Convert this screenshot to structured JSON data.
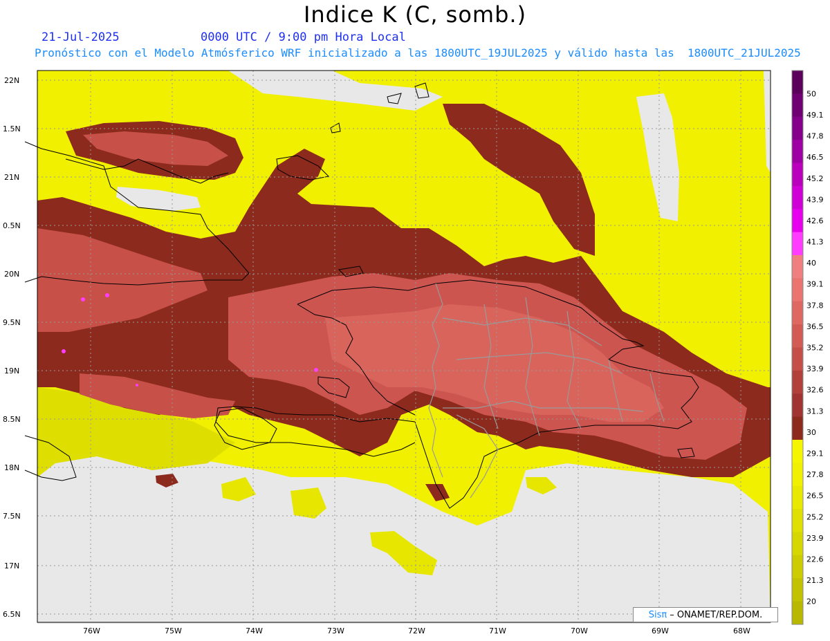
{
  "title": "Indice K (C, somb.)",
  "header": {
    "date": "21-Jul-2025",
    "time": "0000 UTC / 9:00 pm Hora Local",
    "subtitle": "Pronóstico con el Modelo Atmósferico WRF inicializado a las 1800UTC_19JUL2025 y válido hasta las  1800UTC_21JUL2025"
  },
  "axes": {
    "lat_labels": [
      "22N",
      "1.5N",
      "21N",
      "0.5N",
      "20N",
      "9.5N",
      "19N",
      "8.5N",
      "18N",
      "7.5N",
      "17N",
      "6.5N"
    ],
    "lon_labels": [
      "76W",
      "75W",
      "74W",
      "73W",
      "72W",
      "71W",
      "70W",
      "69W",
      "68W"
    ]
  },
  "colorbar": {
    "labels": [
      "50",
      "49.1",
      "47.8",
      "46.5",
      "45.2",
      "43.9",
      "42.6",
      "41.3",
      "40",
      "39.1",
      "37.8",
      "36.5",
      "35.2",
      "33.9",
      "32.6",
      "31.3",
      "30",
      "29.1",
      "27.8",
      "26.5",
      "25.2",
      "23.9",
      "22.6",
      "21.3",
      "20"
    ],
    "colors": [
      "#5a005a",
      "#6f0072",
      "#85008a",
      "#9d00a3",
      "#b800bd",
      "#cf00d6",
      "#e600ee",
      "#ff3cff",
      "#f08080",
      "#e97470",
      "#de6862",
      "#d25c55",
      "#c34f48",
      "#b2413c",
      "#9f3430",
      "#8c2a1d",
      "#f5f500",
      "#f0f000",
      "#e8e800",
      "#dfdf00",
      "#d6d600",
      "#cccc00",
      "#c2c200",
      "#b8b800"
    ]
  },
  "credit": {
    "sis": "Sisπ",
    "org": "– ONAMET/REP.DOM."
  },
  "colors": {
    "land_no_data": "#e8e8e8",
    "yellow": "#f0f000",
    "brown": "#8c2a1d",
    "salmon": "#d25c55"
  }
}
